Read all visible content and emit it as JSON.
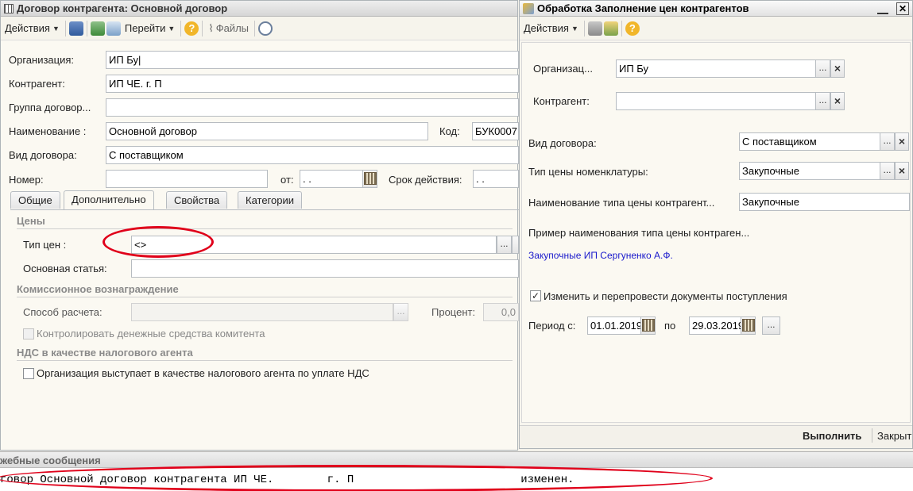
{
  "left": {
    "title": "Договор контрагента: Основной договор",
    "toolbar": {
      "actions": "Действия",
      "goto": "Перейти",
      "files": "Файлы"
    },
    "org_label": "Организация:",
    "org_value": "ИП Бу|",
    "contr_label": "Контрагент:",
    "contr_value": "ИП ЧЕ.                г. П",
    "group_label": "Группа договор...",
    "group_value": "",
    "name_label": "Наименование :",
    "name_value": "Основной договор",
    "code_label": "Код:",
    "code_value": "БУК0007",
    "type_label": "Вид договора:",
    "type_value": "С поставщиком",
    "num_label": "Номер:",
    "num_value": "",
    "from_label": "от:",
    "from_value": "  .  .",
    "term_label": "Срок действия:",
    "term_value": "  .  .",
    "tabs": [
      "Общие",
      "Дополнительно",
      "Свойства",
      "Категории"
    ],
    "prices_section": "Цены",
    "pricetype_label": "Тип цен :",
    "pricetype_value": "<>",
    "article_label": "Основная статья:",
    "article_value": "",
    "commission_section": "Комиссионное вознаграждение",
    "calc_label": "Способ расчета:",
    "percent_label": "Процент:",
    "percent_value": "0,0",
    "control_label": "Контролировать денежные средства комитента",
    "vat_section": "НДС в качестве налогового агента",
    "vat_label": "Организация выступает в качестве налогового агента по уплате НДС"
  },
  "right": {
    "title": "Обработка  Заполнение цен контрагентов",
    "toolbar": {
      "actions": "Действия"
    },
    "org_label": "Организац...",
    "org_value": "ИП Бу",
    "contr_label": "Контрагент:",
    "contr_value": "",
    "type_label": "Вид договора:",
    "type_value": "С поставщиком",
    "nomprice_label": "Тип цены номенклатуры:",
    "nomprice_value": "Закупочные",
    "pricename_label": "Наименование типа цены контрагент...",
    "pricename_value": "Закупочные",
    "example_label": "Пример наименования типа цены контраген...",
    "example_value": "Закупочные ИП Сергуненко А.Ф.",
    "change_label": "Изменить и перепровести документы поступления",
    "period_label": "Период с:",
    "period_from": "01.01.2019",
    "period_to_label": "по",
    "period_to": "29.03.2019",
    "run_button": "Выполнить",
    "close_button": "Закрыт"
  },
  "messages": {
    "title": "жебные сообщения",
    "text": "говор Основной договор контрагента ИП ЧЕ.        г. П                         изменен."
  },
  "colors": {
    "accent_red": "#e0001a",
    "link_blue": "#1a1acc"
  }
}
